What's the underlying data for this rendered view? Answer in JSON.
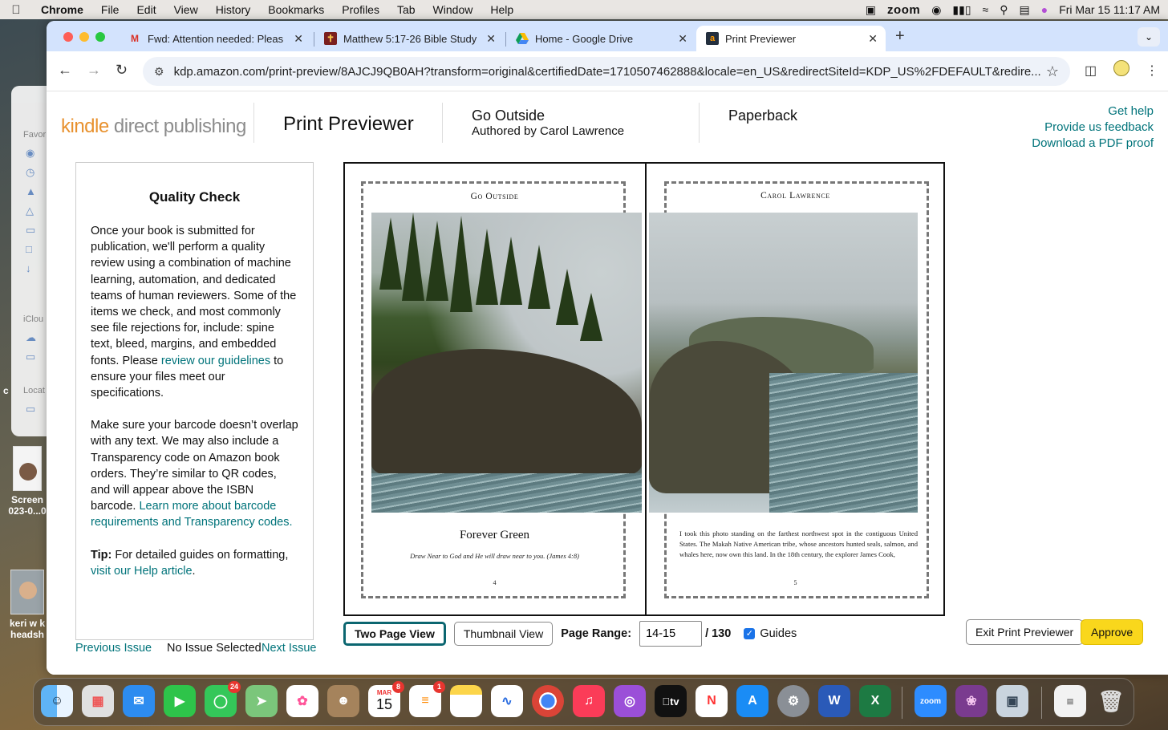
{
  "menubar": {
    "app_name": "Chrome",
    "items": [
      "File",
      "Edit",
      "View",
      "History",
      "Bookmarks",
      "Profiles",
      "Tab",
      "Window",
      "Help"
    ],
    "zoom_label": "zoom",
    "datetime": "Fri Mar 15  11:17 AM"
  },
  "desktop": {
    "finder_labels": [
      "Favor",
      "iClou",
      "Locat"
    ],
    "icon1_label_line1": "Screen",
    "icon1_label_line2": "023-0...0",
    "icon2_label_line1": "keri w k",
    "icon2_label_line2": "headsh",
    "stray_c": "c"
  },
  "tabs": [
    {
      "title": "Fwd: Attention needed: Pleas",
      "favicon": "gmail-icon"
    },
    {
      "title": "Matthew 5:17-26 Bible Study",
      "favicon": "bible-icon"
    },
    {
      "title": "Home - Google Drive",
      "favicon": "google-drive-icon"
    },
    {
      "title": "Print Previewer",
      "favicon": "amazon-icon"
    }
  ],
  "address_bar": {
    "url": "kdp.amazon.com/print-preview/8AJCJ9QB0AH?transform=original&certifiedDate=1710507462888&locale=en_US&redirectSiteId=KDP_US%2FDEFAULT&redire..."
  },
  "header": {
    "logo_kindle": "kindle",
    "logo_rest": " direct publishing",
    "title": "Print Previewer",
    "book_title": "Go Outside",
    "book_author": "Authored by Carol Lawrence",
    "format": "Paperback",
    "links": [
      "Get help",
      "Provide us feedback",
      "Download a PDF proof"
    ]
  },
  "quality_check": {
    "title": "Quality Check",
    "p1_text": "Once your book is submitted for publication, we'll perform a quality review using a combination of machine learning, automation, and dedicated teams of human reviewers. Some of the items we check, and most commonly see file rejections for, include: spine text, bleed, margins, and embedded fonts. Please ",
    "p1_link": "review our guidelines",
    "p1_end": " to ensure your files meet our specifications.",
    "p2_text": "Make sure your barcode doesn’t overlap with any text. We may also include a Transparency code on Amazon book orders. They’re similar to QR codes, and will appear above the ISBN barcode. ",
    "p2_link": "Learn more about barcode requirements and Transparency codes.",
    "tip_label": "Tip:",
    "tip_text": " For detailed guides on formatting, ",
    "tip_link": "visit our Help article",
    "tip_end": "."
  },
  "issue_nav": {
    "previous": "Previous Issue",
    "status": "No Issue Selected",
    "next": "Next Issue"
  },
  "spread": {
    "left": {
      "running_head": "Go Outside",
      "caption_title": "Forever Green",
      "caption_line": "Draw Near to God and He will draw near to you. (James 4:8)",
      "page_number": "4"
    },
    "right": {
      "running_head": "Carol Lawrence",
      "body_text": "I took this photo  standing on the farthest northwest spot in the contiguous United States. The Makah Native American tribe, whose ancestors hunted seals, salmon, and whales here, now own this land. In the 18th century, the explorer James Cook,",
      "page_number": "5"
    }
  },
  "controls": {
    "two_page_view": "Two Page View",
    "thumbnail_view": "Thumbnail View",
    "page_range_label": "Page Range:",
    "page_range_value": "14-15",
    "page_total": "/ 130",
    "guides_label": "Guides",
    "exit": "Exit Print Previewer",
    "approve": "Approve"
  },
  "dock": {
    "messages_badge": "24",
    "calendar_month": "MAR",
    "calendar_day": "15",
    "calendar_badge": "8",
    "reminders_badge": "1",
    "tv_label": "tv",
    "zoom_label": "zoom"
  },
  "colors": {
    "link": "#00737a",
    "approve": "#f9d71c",
    "selected_border": "#0b6670",
    "tabstrip": "#d3e3fd"
  }
}
